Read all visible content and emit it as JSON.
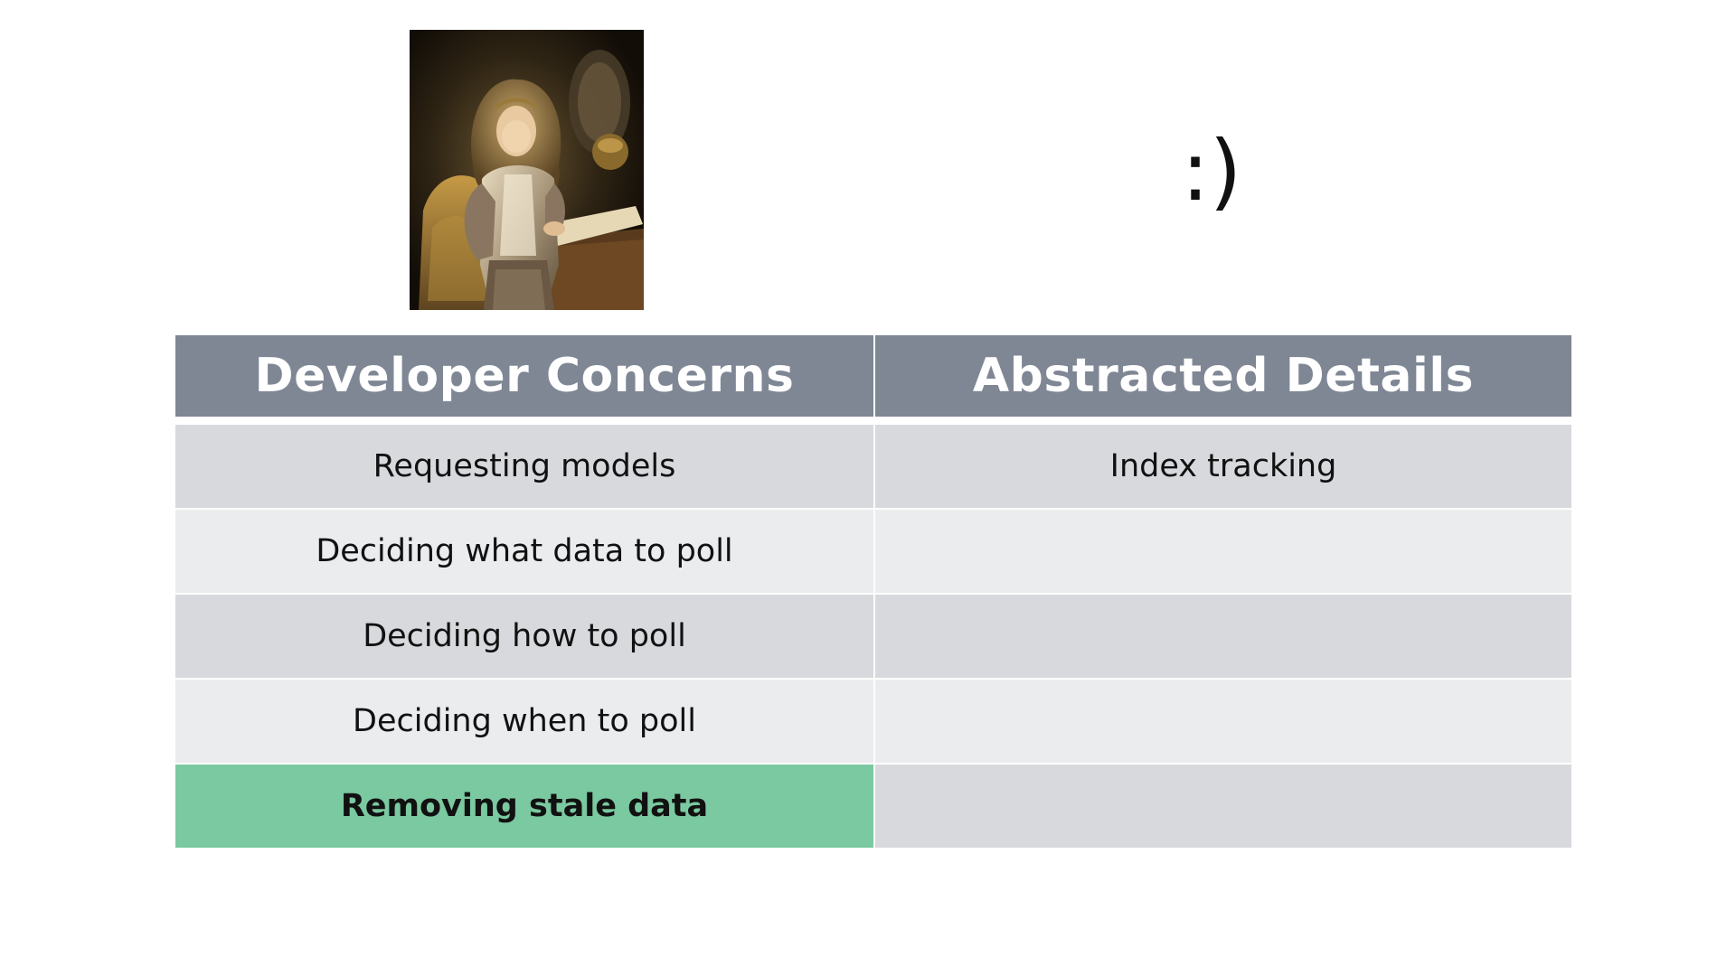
{
  "slide": {
    "emoticon": ":)",
    "table": {
      "headers": [
        "Developer Concerns",
        "Abstracted Details"
      ],
      "rows": [
        {
          "left": "Requesting models",
          "right": "Index tracking"
        },
        {
          "left": "Deciding what data to poll",
          "right": ""
        },
        {
          "left": "Deciding how to poll",
          "right": ""
        },
        {
          "left": "Deciding when to poll",
          "right": ""
        },
        {
          "left": "Removing stale data",
          "right": ""
        }
      ],
      "highlighted_row": 5
    },
    "colors": {
      "header_bg": "#7f8795",
      "row_dark": "#d8d9dd",
      "row_light": "#ebecee",
      "highlight": "#7ac9a0"
    }
  }
}
